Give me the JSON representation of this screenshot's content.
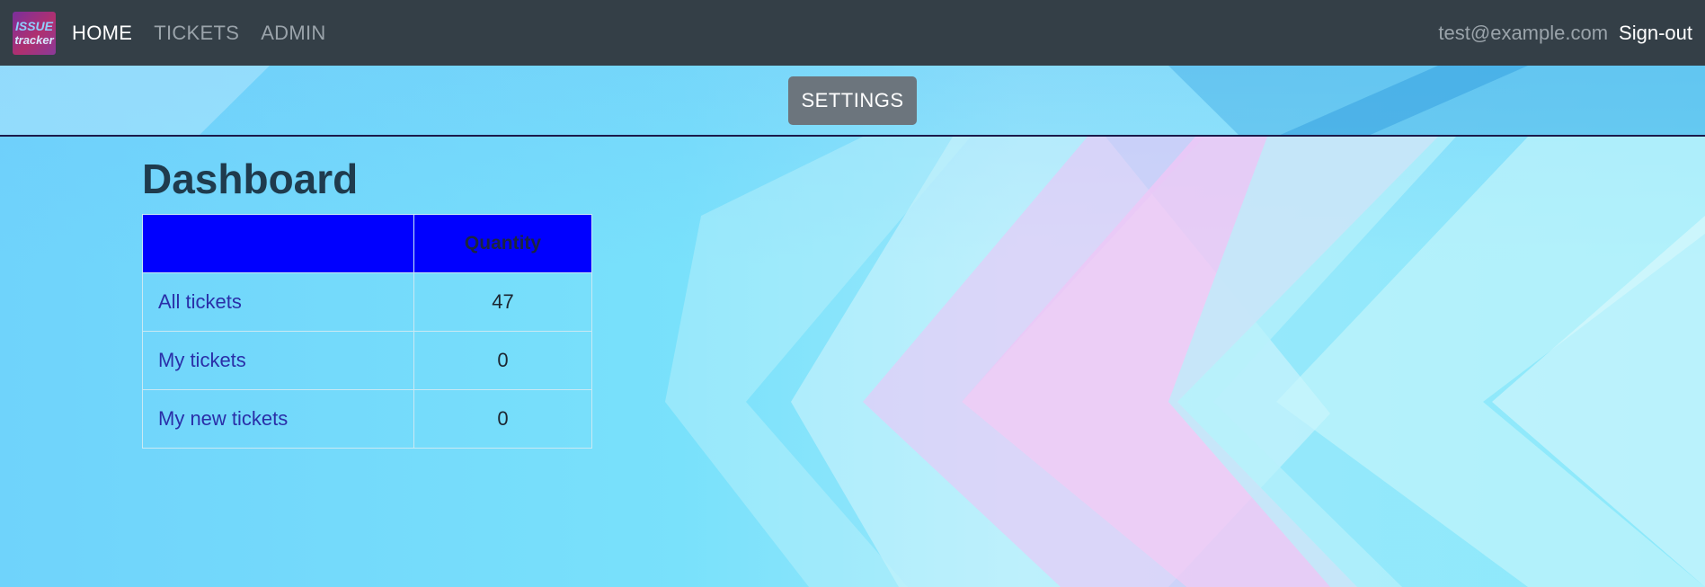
{
  "navbar": {
    "logo": {
      "line1": "ISSUE",
      "line2": "tracker"
    },
    "links": [
      {
        "label": "HOME",
        "active": true
      },
      {
        "label": "TICKETS",
        "active": false
      },
      {
        "label": "ADMIN",
        "active": false
      }
    ],
    "user_email": "test@example.com",
    "signout_label": "Sign-out"
  },
  "toolbar": {
    "settings_label": "SETTINGS"
  },
  "main": {
    "title": "Dashboard",
    "table": {
      "headers": [
        "",
        "Quantity"
      ],
      "rows": [
        {
          "label": "All tickets",
          "quantity": "47"
        },
        {
          "label": "My tickets",
          "quantity": "0"
        },
        {
          "label": "My new tickets",
          "quantity": "0"
        }
      ]
    }
  },
  "colors": {
    "navbar_bg": "#343f47",
    "header_bg": "#0000ff",
    "settings_btn": "#6c757d",
    "link": "#2a2fa8"
  }
}
